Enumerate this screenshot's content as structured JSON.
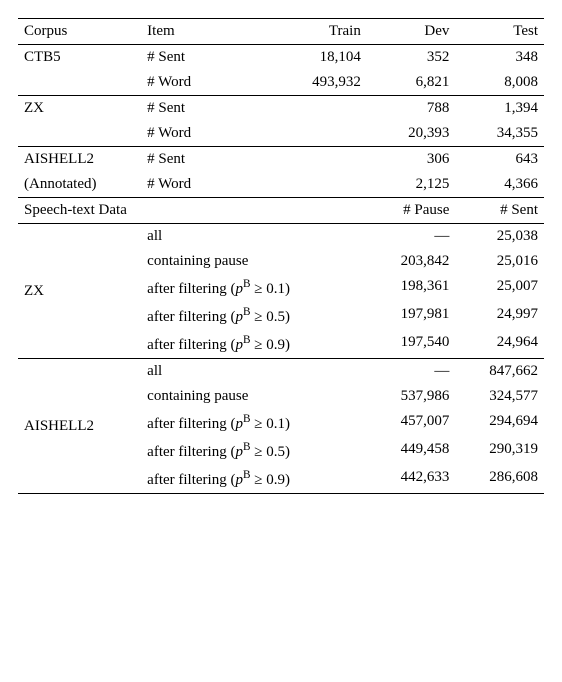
{
  "header": {
    "corpus": "Corpus",
    "item": "Item",
    "train": "Train",
    "dev": "Dev",
    "test": "Test"
  },
  "section1": {
    "groups": [
      {
        "corpus": "CTB5",
        "rows": [
          {
            "item": "# Sent",
            "train": "18,104",
            "dev": "352",
            "test": "348"
          },
          {
            "item": "# Word",
            "train": "493,932",
            "dev": "6,821",
            "test": "8,008"
          }
        ]
      },
      {
        "corpus": "ZX",
        "rows": [
          {
            "item": "# Sent",
            "train": "",
            "dev": "788",
            "test": "1,394"
          },
          {
            "item": "# Word",
            "train": "",
            "dev": "20,393",
            "test": "34,355"
          }
        ]
      },
      {
        "corpus_line1": "AISHELL2",
        "corpus_line2": "(Annotated)",
        "rows": [
          {
            "item": "# Sent",
            "train": "",
            "dev": "306",
            "test": "643"
          },
          {
            "item": "# Word",
            "train": "",
            "dev": "2,125",
            "test": "4,366"
          }
        ]
      }
    ]
  },
  "header2": {
    "label": "Speech-text Data",
    "pause": "# Pause",
    "sent": "# Sent"
  },
  "filters": {
    "f01_pre": "after filtering (",
    "f01_var": "p",
    "f01_sup": "B",
    "f01_post": " ≥ 0.1)",
    "f05_post": " ≥ 0.5)",
    "f09_post": " ≥ 0.9)"
  },
  "section2": {
    "groups": [
      {
        "corpus": "ZX",
        "rows": [
          {
            "item_plain": "all",
            "pause": "—",
            "sent": "25,038"
          },
          {
            "item_plain": "containing pause",
            "pause": "203,842",
            "sent": "25,016"
          },
          {
            "filter": "0.1",
            "pause": "198,361",
            "sent": "25,007"
          },
          {
            "filter": "0.5",
            "pause": "197,981",
            "sent": "24,997"
          },
          {
            "filter": "0.9",
            "pause": "197,540",
            "sent": "24,964"
          }
        ]
      },
      {
        "corpus": "AISHELL2",
        "rows": [
          {
            "item_plain": "all",
            "pause": "—",
            "sent": "847,662"
          },
          {
            "item_plain": "containing pause",
            "pause": "537,986",
            "sent": "324,577"
          },
          {
            "filter": "0.1",
            "pause": "457,007",
            "sent": "294,694"
          },
          {
            "filter": "0.5",
            "pause": "449,458",
            "sent": "290,319"
          },
          {
            "filter": "0.9",
            "pause": "442,633",
            "sent": "286,608"
          }
        ]
      }
    ]
  }
}
